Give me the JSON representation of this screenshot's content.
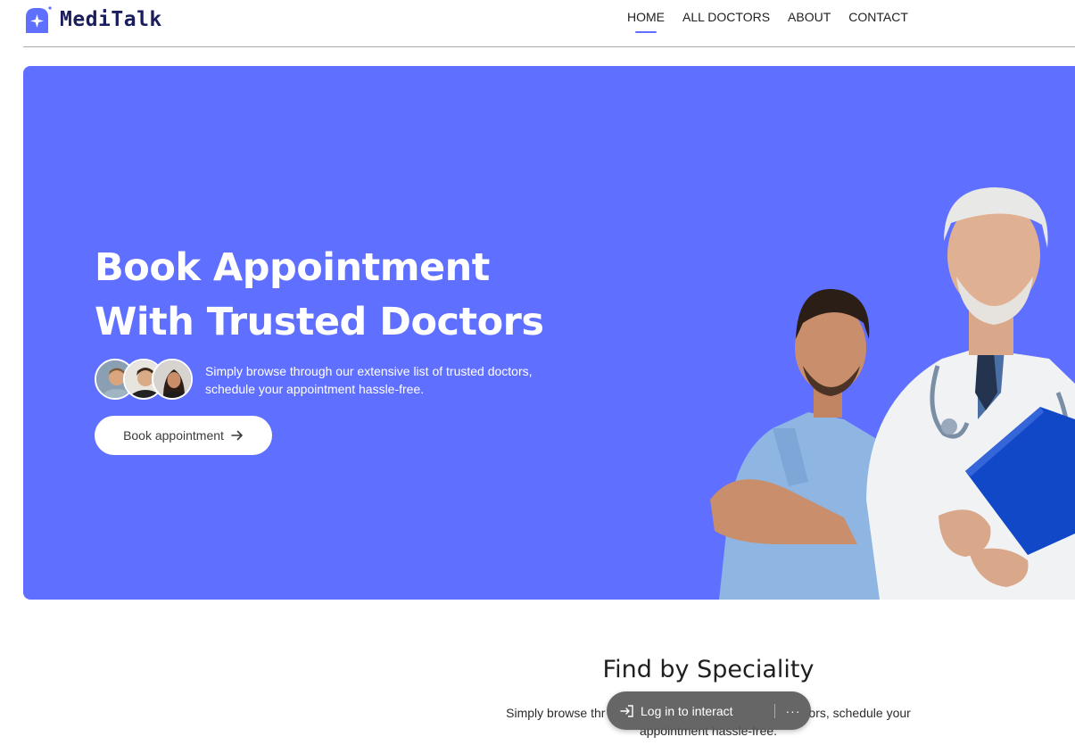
{
  "brand": {
    "name": "MediTalk",
    "icon": "sparkle-house-icon",
    "accent": "#5f6fff",
    "text_color": "#1b1e5c"
  },
  "nav": {
    "items": [
      {
        "label": "HOME",
        "active": true
      },
      {
        "label": "ALL DOCTORS",
        "active": false
      },
      {
        "label": "ABOUT",
        "active": false
      },
      {
        "label": "CONTACT",
        "active": false
      }
    ]
  },
  "hero": {
    "background": "#5f6fff",
    "title_line1": "Book Appointment",
    "title_line2": "With Trusted Doctors",
    "desc_line1": "Simply browse through our extensive list of trusted doctors,",
    "desc_line2": "schedule your appointment hassle-free.",
    "button_label": "Book appointment",
    "button_icon": "arrow-right-icon"
  },
  "speciality": {
    "title": "Find by Speciality",
    "desc_line1": "Simply browse thr",
    "desc_line1_end": "ors, schedule your",
    "desc_line2": "appointment hassle-free."
  },
  "overlay": {
    "login_label": "Log in to interact",
    "login_icon": "sign-in-icon",
    "more_icon": "more-dots-icon",
    "more_label": "···"
  }
}
